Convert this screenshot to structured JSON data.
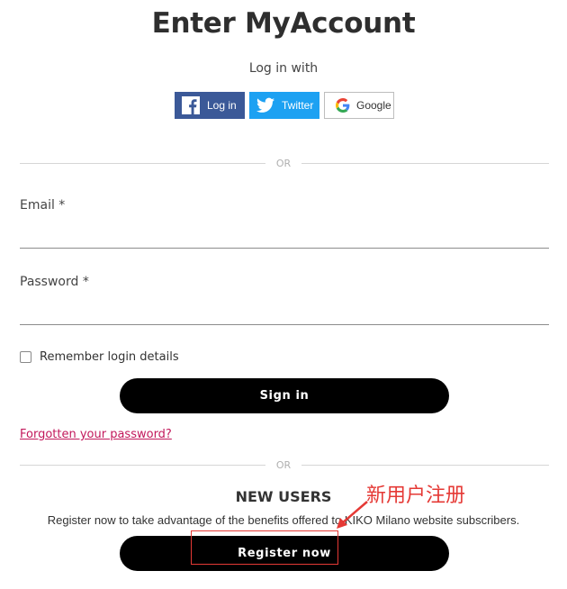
{
  "page_title": "Enter MyAccount",
  "login_with_label": "Log in with",
  "social": {
    "facebook_label": "Log in",
    "twitter_label": "Twitter",
    "google_label": "Google"
  },
  "or_label": "OR",
  "form": {
    "email_label": "Email *",
    "email_value": "",
    "password_label": "Password *",
    "password_value": "",
    "remember_label": "Remember login details",
    "remember_checked": false,
    "sign_in_label": "Sign in",
    "forgot_link": "Forgotten your password?"
  },
  "new_users": {
    "heading": "NEW USERS",
    "text": "Register now to take advantage of the benefits offered to KIKO Milano website subscribers.",
    "register_label": "Register now"
  },
  "annotation": {
    "text": "新用户注册",
    "color": "#e53935"
  },
  "colors": {
    "facebook": "#3b5998",
    "twitter": "#1da1f2",
    "link": "#c2185b",
    "button": "#000000"
  },
  "icons": {
    "facebook": "facebook-icon",
    "twitter": "twitter-icon",
    "google": "google-icon"
  }
}
